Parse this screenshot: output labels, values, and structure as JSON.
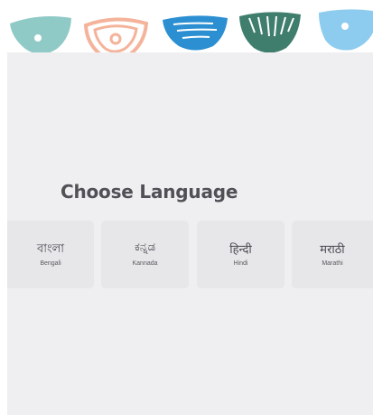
{
  "screen": {
    "title": "Choose Language"
  },
  "languages": [
    {
      "native": "বাংলা",
      "english": "Bengali"
    },
    {
      "native": "ಕನ್ನಡ",
      "english": "Kannada"
    },
    {
      "native": "हिन्दी",
      "english": "Hindi"
    },
    {
      "native": "मराठी",
      "english": "Marathi"
    }
  ],
  "colors": {
    "panel_background": "#efeff1",
    "card_background": "#e7e7ea",
    "decor_teal": "#8fcac6",
    "decor_peach": "#f4b39a",
    "decor_blue": "#2b8fd2",
    "decor_green": "#3f7d6c",
    "decor_light_blue": "#8dccef"
  },
  "decorations": [
    {
      "icon": "teal-dot-bowl-icon"
    },
    {
      "icon": "peach-concentric-bowl-icon"
    },
    {
      "icon": "blue-striped-bowl-icon"
    },
    {
      "icon": "green-fringe-bowl-icon"
    },
    {
      "icon": "light-blue-dot-bowl-icon"
    }
  ]
}
